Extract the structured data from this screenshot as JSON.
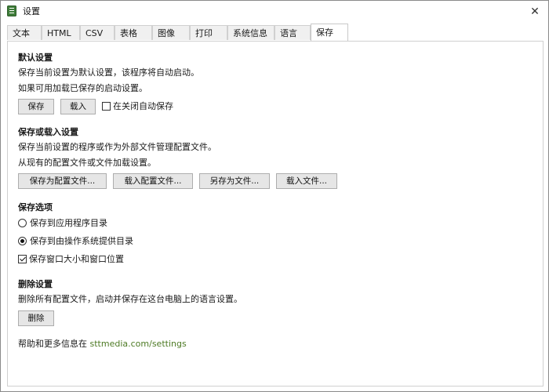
{
  "window": {
    "title": "设置",
    "close_glyph": "✕"
  },
  "tabs": [
    {
      "label": "文本"
    },
    {
      "label": "HTML"
    },
    {
      "label": "CSV"
    },
    {
      "label": "表格"
    },
    {
      "label": "图像"
    },
    {
      "label": "打印"
    },
    {
      "label": "系统信息"
    },
    {
      "label": "语言"
    },
    {
      "label": "保存",
      "active": true
    }
  ],
  "default_settings": {
    "title": "默认设置",
    "desc1": "保存当前设置为默认设置，该程序将自动启动。",
    "desc2": "如果可用加载已保存的启动设置。",
    "save_button": "保存",
    "load_button": "载入",
    "autosave_checkbox": {
      "label": "在关闭自动保存",
      "checked": false
    }
  },
  "save_load": {
    "title": "保存或载入设置",
    "desc1": "保存当前设置的程序或作为外部文件管理配置文件。",
    "desc2": "从现有的配置文件或文件加载设置。",
    "save_profile_button": "保存为配置文件...",
    "load_profile_button": "载入配置文件...",
    "save_as_file_button": "另存为文件...",
    "load_file_button": "载入文件..."
  },
  "save_options": {
    "title": "保存选项",
    "radio_app_dir": {
      "label": "保存到应用程序目录",
      "checked": false
    },
    "radio_os_dir": {
      "label": "保存到由操作系统提供目录",
      "checked": true
    },
    "window_checkbox": {
      "label": "保存窗口大小和窗口位置",
      "checked": true
    }
  },
  "delete_settings": {
    "title": "删除设置",
    "desc": "删除所有配置文件，启动并保存在这台电脑上的语言设置。",
    "delete_button": "删除"
  },
  "footer": {
    "help_prefix": "帮助和更多信息在",
    "help_link": "sttmedia.com/settings"
  },
  "colors": {
    "link": "#4d7a24",
    "accent_icon": "#3f7d3a"
  },
  "icons": {
    "app": "notepad-icon",
    "close": "close-icon"
  }
}
